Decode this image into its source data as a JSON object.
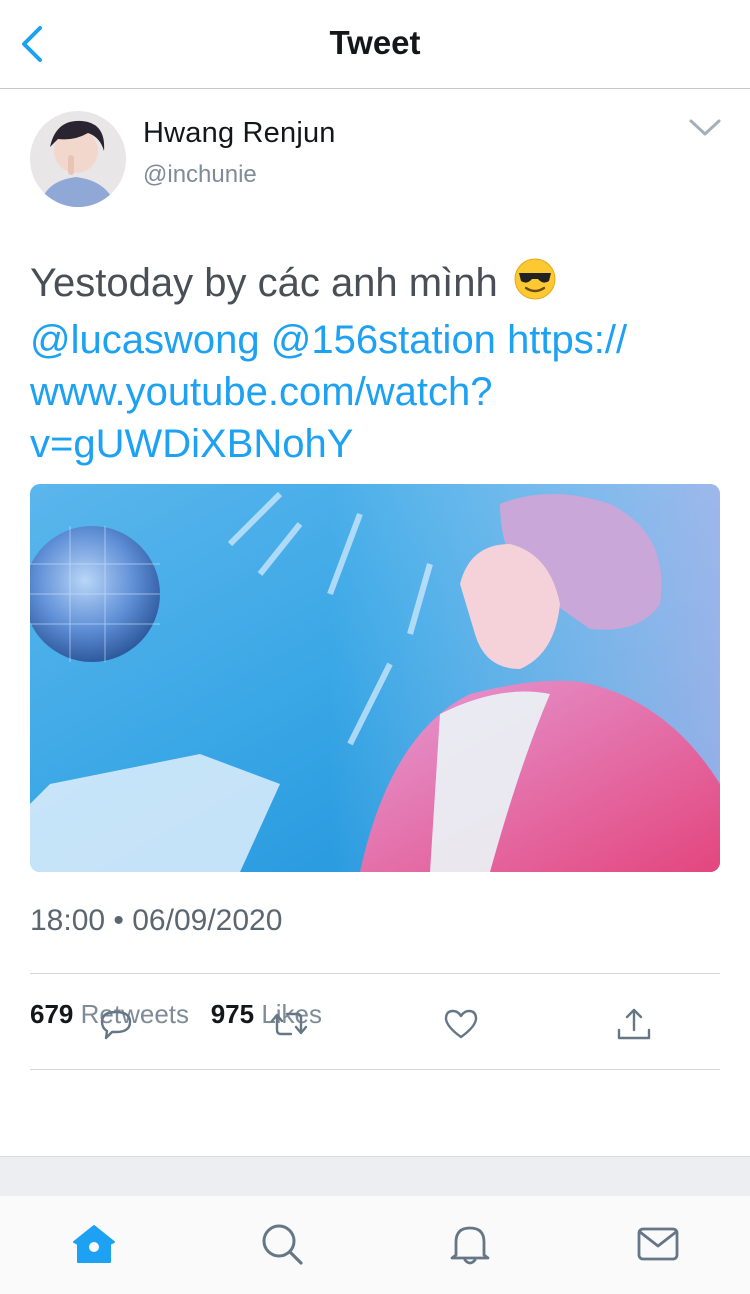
{
  "header": {
    "title": "Tweet",
    "back_icon": "chevron-left-icon"
  },
  "tweet": {
    "author_name": "Hwang Renjun",
    "author_handle": "@inchunie",
    "text_plain": "Yestoday by các anh mình",
    "emoji": "😎",
    "mention_1": "@lucaswong",
    "mention_2": "@156station",
    "url_line_1": "https://",
    "url_line_2": "www.youtube.com/watch?",
    "url_line_3": "v=gUWDiXBNohY",
    "timestamp": "18:00 • 06/09/2020",
    "retweets_count": "679",
    "retweets_label": "Retweets",
    "likes_count": "975",
    "likes_label": "Likes"
  },
  "actions": [
    "reply-icon",
    "retweet-icon",
    "like-icon",
    "share-icon"
  ],
  "tabbar": [
    "home-icon",
    "search-icon",
    "notifications-icon",
    "messages-icon"
  ],
  "colors": {
    "accent": "#1da1f2",
    "text": "#14171a",
    "muted": "#7f8c97"
  }
}
